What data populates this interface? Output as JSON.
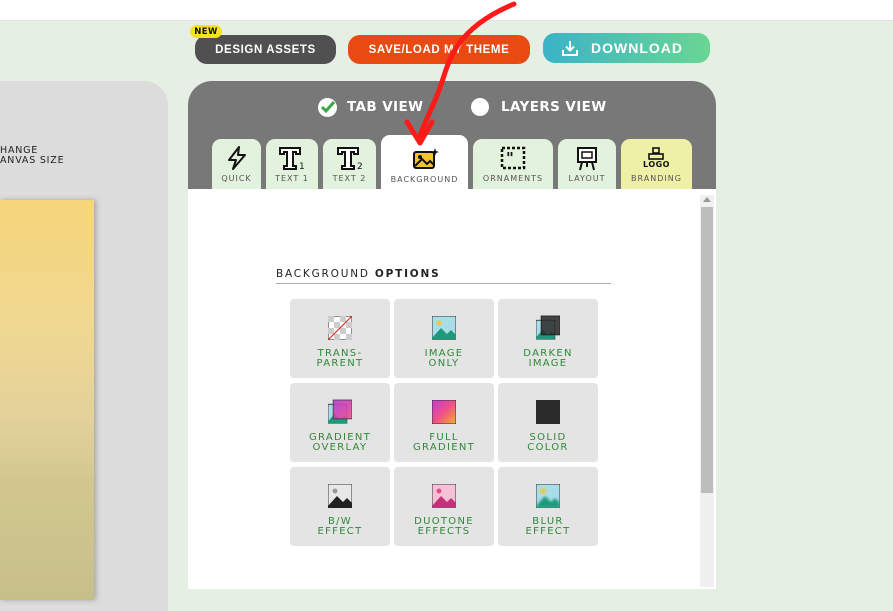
{
  "left": {
    "change_size_line1": "HANGE",
    "change_size_line2": "ANVAS SIZE"
  },
  "toolbar": {
    "new_badge": "NEW",
    "design_assets": "DESIGN ASSETS",
    "save_load_theme": "SAVE/LOAD MY THEME",
    "download": "DOWNLOAD"
  },
  "views": {
    "tab_view": "TAB VIEW",
    "layers_view": "LAYERS VIEW",
    "selected": "TAB VIEW"
  },
  "tabs": [
    {
      "label": "QUICK",
      "icon": "lightning-icon"
    },
    {
      "label": "TEXT 1",
      "icon": "text1-icon"
    },
    {
      "label": "TEXT 2",
      "icon": "text2-icon"
    },
    {
      "label": "BACKGROUND",
      "icon": "background-icon",
      "active": true
    },
    {
      "label": "ORNAMENTS",
      "icon": "ornaments-icon"
    },
    {
      "label": "LAYOUT",
      "icon": "easel-icon"
    },
    {
      "label": "BRANDING",
      "icon": "logo-stamp-icon",
      "icon_text": "LOGO"
    }
  ],
  "section": {
    "title_prefix": "BACKGROUND ",
    "title_bold": "OPTIONS"
  },
  "options": [
    {
      "label": "TRANS-\nPARENT",
      "icon": "transparent-icon"
    },
    {
      "label": "IMAGE\nONLY",
      "icon": "image-icon"
    },
    {
      "label": "DARKEN\nIMAGE",
      "icon": "darken-image-icon"
    },
    {
      "label": "GRADIENT\nOVERLAY",
      "icon": "gradient-overlay-icon"
    },
    {
      "label": "FULL\nGRADIENT",
      "icon": "full-gradient-icon"
    },
    {
      "label": "SOLID\nCOLOR",
      "icon": "solid-color-icon"
    },
    {
      "label": "B/W\nEFFECT",
      "icon": "bw-effect-icon"
    },
    {
      "label": "DUOTONE\nEFFECTS",
      "icon": "duotone-icon"
    },
    {
      "label": "BLUR\nEFFECT",
      "icon": "blur-effect-icon"
    }
  ],
  "colors": {
    "accent_green": "#2e8a36",
    "save_button": "#e94a12",
    "assets_button": "#505050",
    "panel_header": "#787878",
    "annotation_arrow": "#ff0000"
  }
}
